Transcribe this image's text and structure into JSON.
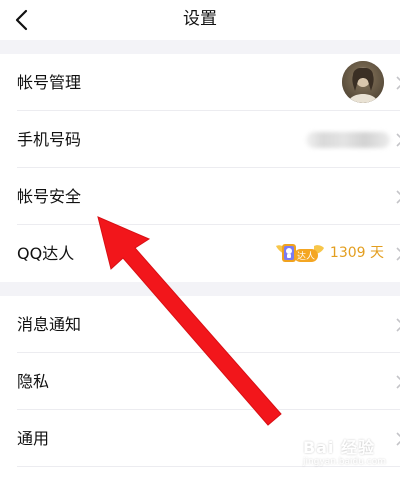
{
  "nav": {
    "title": "设置",
    "back_icon": "chevron-left-icon"
  },
  "group1": {
    "items": [
      {
        "label": "帐号管理",
        "accessory": "avatar"
      },
      {
        "label": "手机号码",
        "accessory": "blurred-phone-number"
      },
      {
        "label": "帐号安全",
        "accessory": "none"
      },
      {
        "label": "QQ达人",
        "accessory": "qq-talent-badge",
        "badge_text": "达人",
        "days": "1309 天"
      }
    ]
  },
  "group2": {
    "items": [
      {
        "label": "消息通知"
      },
      {
        "label": "隐私"
      },
      {
        "label": "通用"
      }
    ]
  },
  "colors": {
    "accent_gold": "#e39e1f",
    "annotation_red": "#f2161b",
    "section_gap": "#f3f3f7",
    "divider": "#ececf0"
  },
  "watermark": {
    "main": "Bai 经验",
    "sub": "jingyan.baidu.com"
  }
}
